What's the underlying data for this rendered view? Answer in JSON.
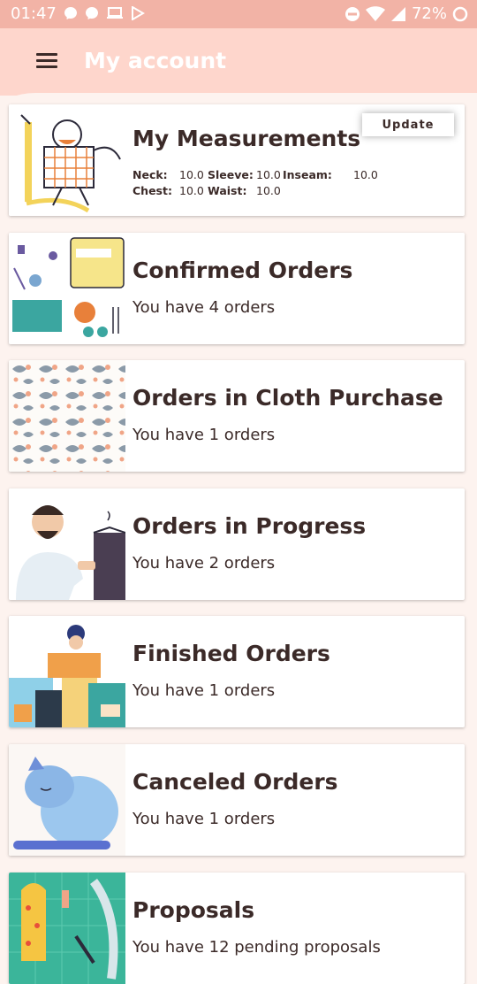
{
  "status_bar": {
    "time": "01:47",
    "battery_percent": "72%",
    "left_icons": [
      "messenger-icon",
      "messenger-icon",
      "laptop-icon",
      "play-store-icon"
    ],
    "right_icons": [
      "do-not-disturb-icon",
      "wifi-icon",
      "cell-signal-icon",
      "battery-icon"
    ]
  },
  "app_bar": {
    "title": "My account",
    "menu_icon": "hamburger-menu-icon"
  },
  "measurements": {
    "title": "My Measurements",
    "update_label": "Update",
    "neck_label": "Neck:",
    "neck_value": "10.0",
    "sleeve_label": "Sleeve:",
    "sleeve_value": "10.0",
    "inseam_label": "Inseam:",
    "inseam_value": "10.0",
    "chest_label": "Chest:",
    "chest_value": "10.0",
    "waist_label": "Waist:",
    "waist_value": "10.0"
  },
  "cards": [
    {
      "title": "Confirmed Orders",
      "subtitle": "You have 4 orders",
      "image": "sewing-tools-illustration"
    },
    {
      "title": "Orders in Cloth Purchase",
      "subtitle": "You have 1 orders",
      "image": "floral-fabric-pattern"
    },
    {
      "title": "Orders in Progress",
      "subtitle": "You have 2 orders",
      "image": "tailor-with-jacket-illustration"
    },
    {
      "title": "Finished Orders",
      "subtitle": "You have 1 orders",
      "image": "woman-with-packages-illustration"
    },
    {
      "title": "Canceled Orders",
      "subtitle": "You have 1 orders",
      "image": "sad-blue-animal-illustration"
    },
    {
      "title": "Proposals",
      "subtitle": "You have 12 pending proposals",
      "image": "pattern-cutting-illustration"
    }
  ]
}
